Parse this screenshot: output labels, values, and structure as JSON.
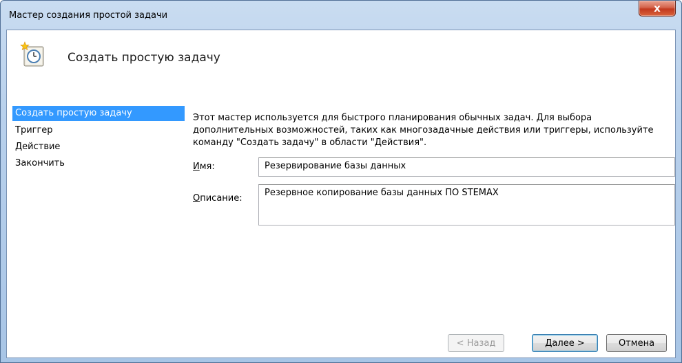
{
  "window": {
    "title": "Мастер создания простой задачи",
    "close_glyph": "x"
  },
  "header": {
    "title": "Создать простую задачу",
    "icon": "task-scheduler-clock-icon"
  },
  "nav": {
    "items": [
      {
        "label": "Создать простую задачу",
        "active": true
      },
      {
        "label": "Триггер",
        "active": false
      },
      {
        "label": "Действие",
        "active": false
      },
      {
        "label": "Закончить",
        "active": false
      }
    ]
  },
  "form": {
    "intro": "Этот мастер используется для быстрого планирования обычных задач.  Для выбора дополнительных возможностей, таких как многозадачные действия или триггеры, используйте команду \"Создать задачу\" в области \"Действия\".",
    "name_label": "Имя:",
    "name_value": "Резервирование базы данных",
    "description_label": "Описание:",
    "description_value": "Резервное копирование базы данных ПО STEMAX"
  },
  "buttons": {
    "back": "< Назад",
    "next": "Далее >",
    "cancel": "Отмена"
  },
  "colors": {
    "selection": "#3399ff",
    "title_gradient_top": "#c9dcf1",
    "close_button": "#c2391f"
  }
}
